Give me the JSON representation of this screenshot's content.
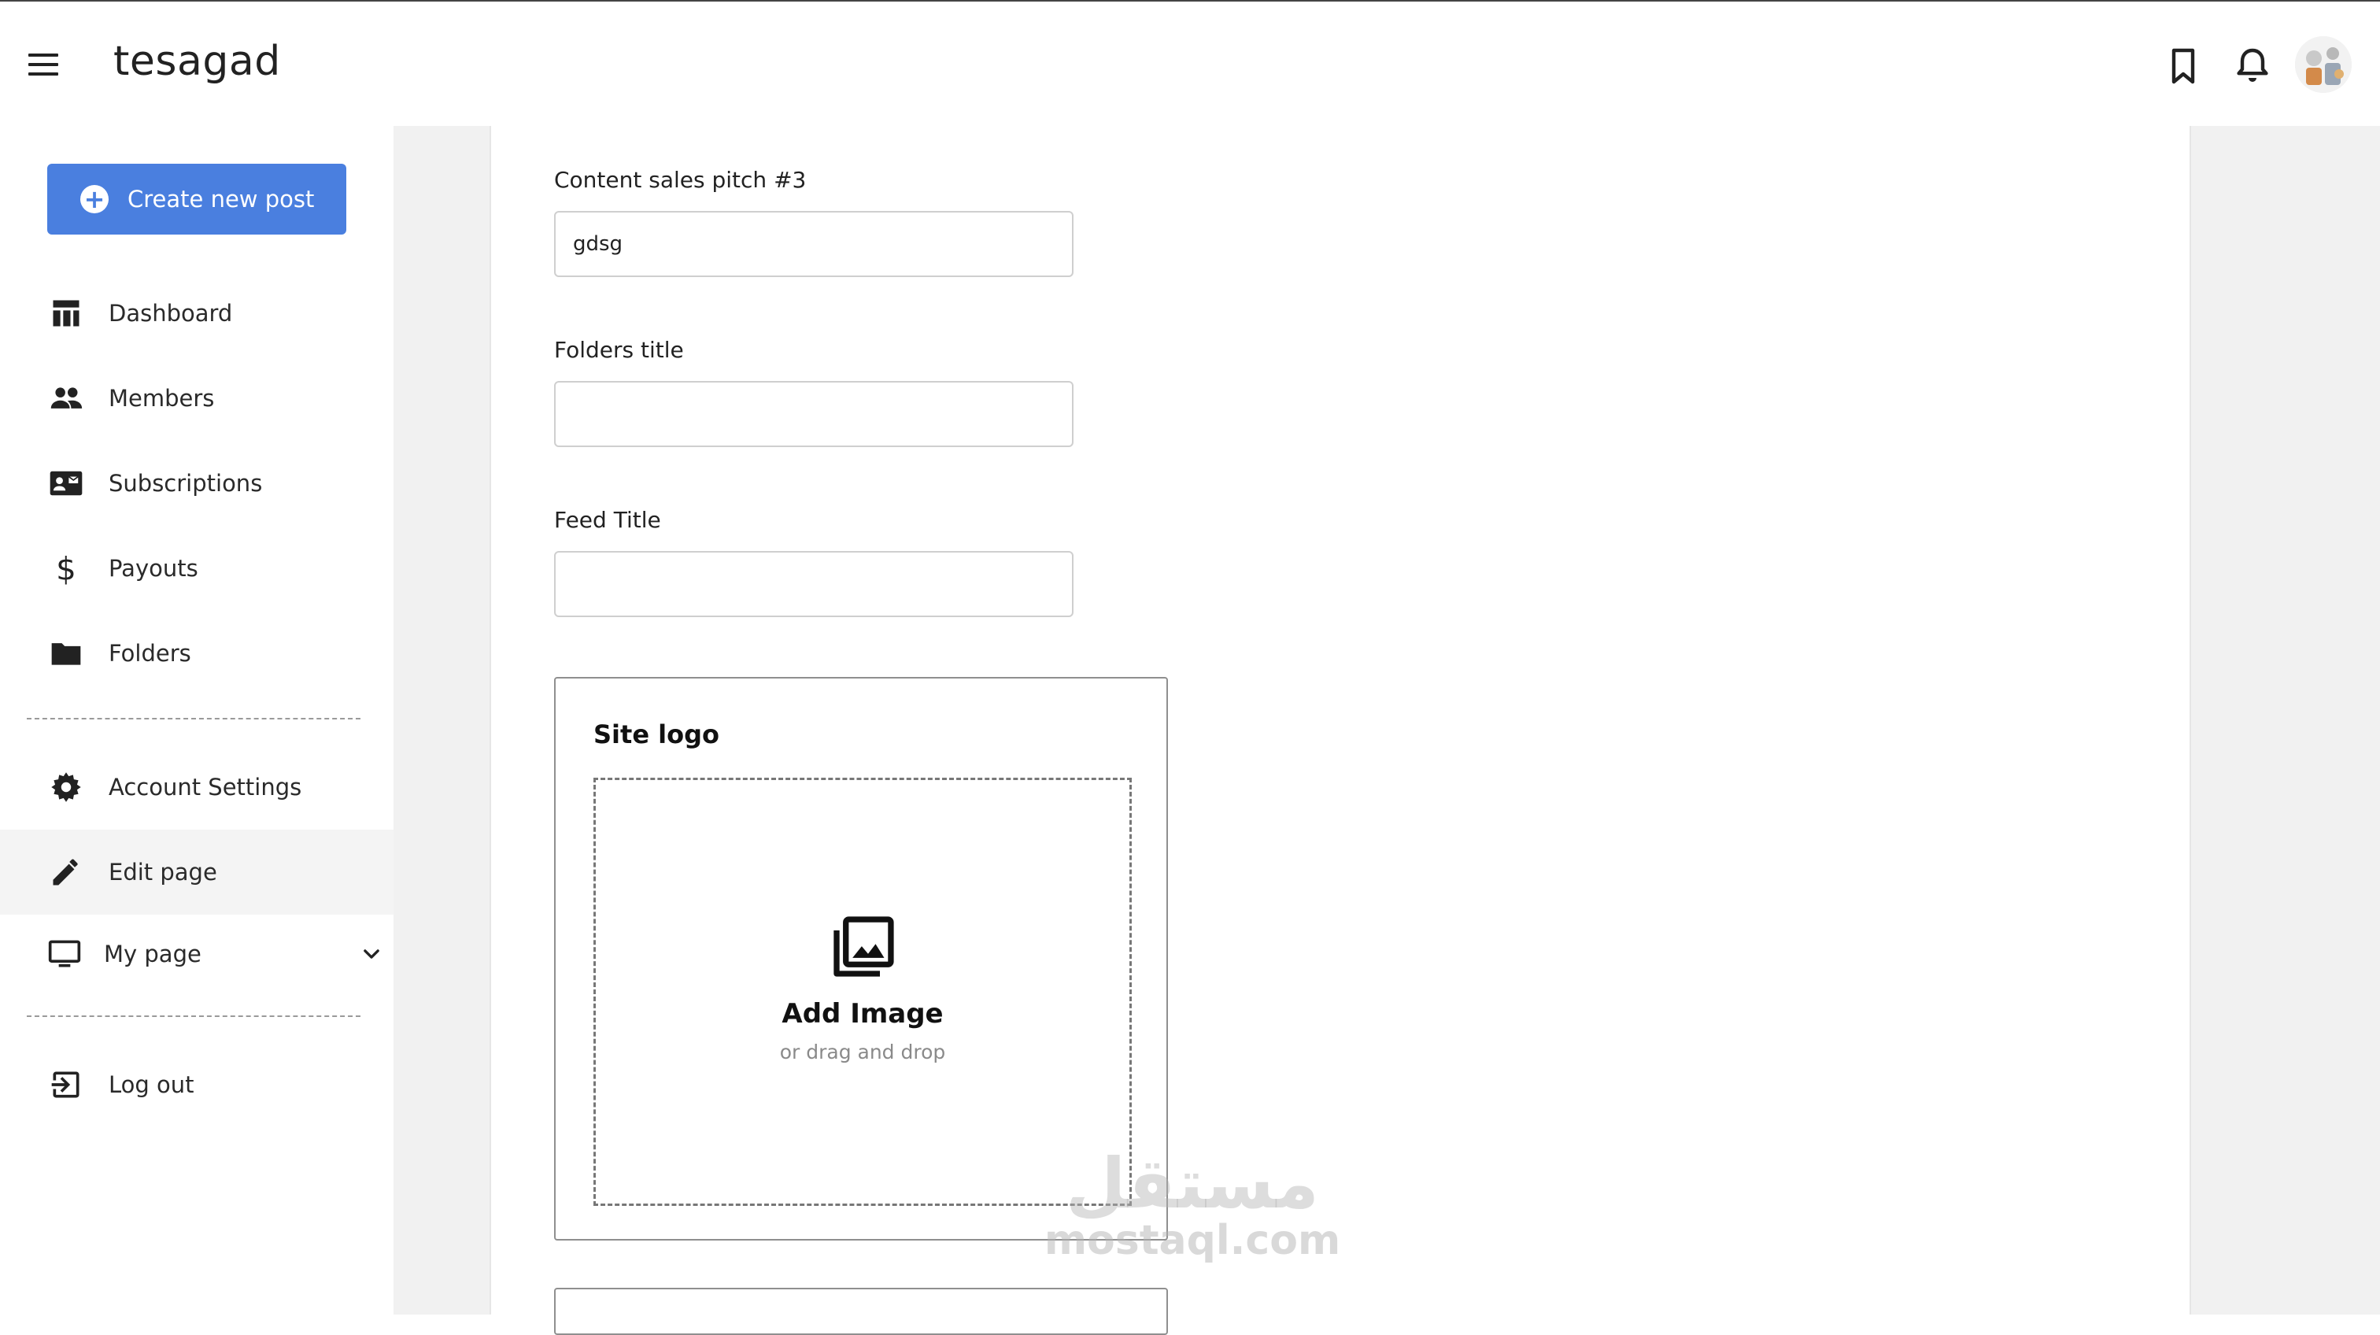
{
  "header": {
    "app_title": "tesagad",
    "menu_icon": "hamburger-menu-icon",
    "bookmark_icon": "bookmark-icon",
    "bell_icon": "bell-icon",
    "avatar": "user-avatar"
  },
  "sidebar": {
    "create_button_label": "Create new post",
    "items": [
      {
        "label": "Dashboard",
        "icon": "dashboard-icon"
      },
      {
        "label": "Members",
        "icon": "people-icon"
      },
      {
        "label": "Subscriptions",
        "icon": "contact-card-icon"
      },
      {
        "label": "Payouts",
        "icon": "dollar-icon"
      },
      {
        "label": "Folders",
        "icon": "folder-icon"
      }
    ],
    "settings_items": [
      {
        "label": "Account Settings",
        "icon": "gear-icon"
      },
      {
        "label": "Edit page",
        "icon": "pencil-icon",
        "active": true
      },
      {
        "label": "My page",
        "icon": "monitor-icon"
      }
    ],
    "logout_label": "Log out"
  },
  "form": {
    "pitch3": {
      "label": "Content sales pitch #3",
      "value": "gdsg"
    },
    "folders_title": {
      "label": "Folders title",
      "value": ""
    },
    "feed_title": {
      "label": "Feed Title",
      "value": ""
    },
    "site_logo": {
      "title": "Site logo",
      "add_image": "Add Image",
      "drag_hint": "or drag and drop"
    }
  },
  "watermark": {
    "arabic": "مستقل",
    "latin": "mostaql.com"
  },
  "colors": {
    "accent": "#4a7fdf",
    "gutter": "#f1f1f1",
    "active_nav": "#f4f4f4"
  }
}
